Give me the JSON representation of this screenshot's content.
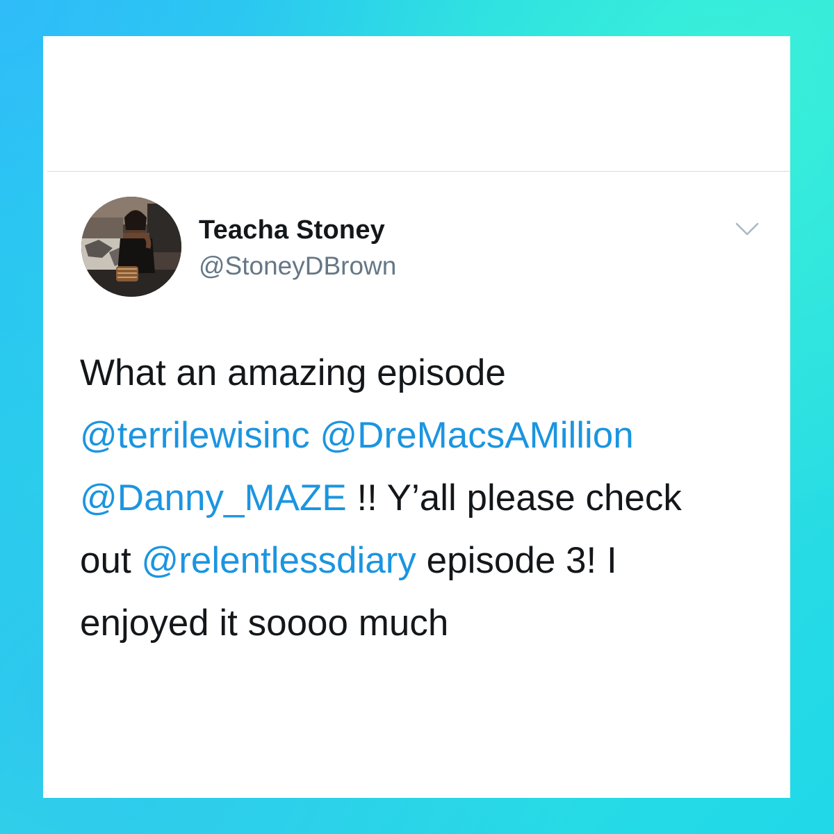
{
  "colors": {
    "accent": "#1b95e0",
    "text": "#14171a",
    "secondary": "#657786"
  },
  "tweet": {
    "author": {
      "display_name": "Teacha Stoney",
      "handle": "@StoneyDBrown",
      "avatar_icon": "profile-photo"
    },
    "menu_icon": "chevron-down-icon",
    "lines": [
      [
        {
          "type": "text",
          "text": "What an amazing episode"
        }
      ],
      [
        {
          "type": "mention",
          "text": "@terrilewisinc"
        },
        {
          "type": "text",
          "text": " "
        },
        {
          "type": "mention",
          "text": "@DreMacsAMillion"
        }
      ],
      [
        {
          "type": "mention",
          "text": "@Danny_MAZE"
        },
        {
          "type": "text",
          "text": " !! Y’all please check"
        }
      ],
      [
        {
          "type": "text",
          "text": "out "
        },
        {
          "type": "mention",
          "text": "@relentlessdiary"
        },
        {
          "type": "text",
          "text": " episode 3! I"
        }
      ],
      [
        {
          "type": "text",
          "text": "enjoyed it soooo much"
        }
      ]
    ]
  }
}
